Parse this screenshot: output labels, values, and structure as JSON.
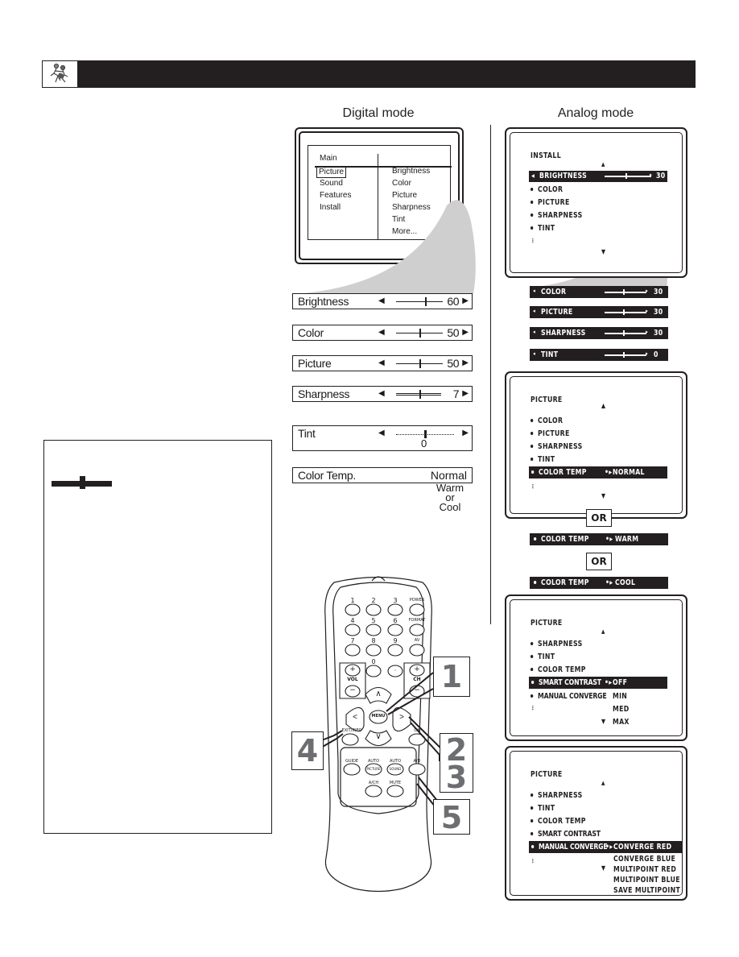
{
  "header": {
    "icon": "wrestlers-icon",
    "accent_color": "#231f20"
  },
  "digital": {
    "title": "Digital mode",
    "menu": {
      "left_header": "Main",
      "left_items": [
        "Picture",
        "Sound",
        "Features",
        "Install"
      ],
      "selected_left": "Picture",
      "right_items": [
        "Brightness",
        "Color",
        "Picture",
        "Sharpness",
        "Tint",
        "More..."
      ]
    },
    "rows": [
      {
        "label": "Brightness",
        "value": "60",
        "position": 0.62
      },
      {
        "label": "Color",
        "value": "50",
        "position": 0.5
      },
      {
        "label": "Picture",
        "value": "50",
        "position": 0.5
      },
      {
        "label": "Sharpness",
        "value": "7",
        "position": 0.5
      },
      {
        "label": "Tint",
        "value": "0",
        "position": 0.5
      }
    ],
    "color_temp": {
      "label": "Color Temp.",
      "value": "Normal",
      "alternatives": [
        "Warm",
        "or",
        "Cool"
      ]
    }
  },
  "analog": {
    "title": "Analog mode",
    "screen1": {
      "title": "INSTALL",
      "highlight": {
        "label": "BRIGHTNESS",
        "value": "30",
        "position": 0.45
      },
      "items": [
        "COLOR",
        "PICTURE",
        "SHARPNESS",
        "TINT"
      ]
    },
    "bars": [
      {
        "label": "COLOR",
        "value": "30",
        "position": 0.45
      },
      {
        "label": "PICTURE",
        "value": "30",
        "position": 0.45
      },
      {
        "label": "SHARPNESS",
        "value": "30",
        "position": 0.45
      },
      {
        "label": "TINT",
        "value": "0",
        "position": 0.45
      }
    ],
    "screen2": {
      "title": "PICTURE",
      "items": [
        "COLOR",
        "PICTURE",
        "SHARPNESS",
        "TINT"
      ],
      "highlight": {
        "label": "COLOR TEMP",
        "value": "NORMAL"
      }
    },
    "or_label": "OR",
    "color_temp_alts": [
      {
        "label": "COLOR TEMP",
        "value": "WARM"
      },
      {
        "label": "COLOR TEMP",
        "value": "COOL"
      }
    ],
    "screen3": {
      "title": "PICTURE",
      "items": [
        "SHARPNESS",
        "TINT",
        "COLOR TEMP"
      ],
      "highlight": {
        "label": "SMART CONTRAST",
        "value": "OFF"
      },
      "after_item": "MANUAL CONVERGE",
      "options": [
        "MIN",
        "MED",
        "MAX"
      ]
    },
    "screen4": {
      "title": "PICTURE",
      "items": [
        "SHARPNESS",
        "TINT",
        "COLOR TEMP",
        "SMART CONTRAST"
      ],
      "highlight": {
        "label": "MANUAL CONVERGE",
        "value": "CONVERGE RED"
      },
      "options": [
        "CONVERGE BLUE",
        "MULTIPOINT RED",
        "MULTIPOINT BLUE",
        "SAVE MULTIPOINT"
      ]
    }
  },
  "remote": {
    "number_keys": [
      "1",
      "2",
      "3",
      "4",
      "5",
      "6",
      "7",
      "8",
      "9",
      "0",
      "·"
    ],
    "side_keys": [
      "POWER",
      "FORMAT",
      "AV"
    ],
    "vol_label": "VOL",
    "ch_label": "CH",
    "plus": "+",
    "minus": "−",
    "menu_label": "MENU",
    "exit_label": "EXIT/INFO",
    "ok_label": "OK",
    "lower_keys": [
      "GUIDE",
      "AUTO",
      "AUTO",
      "A/D",
      "A/CH",
      "MUTE"
    ],
    "lower_sub": [
      "PICTURE",
      "SOUND"
    ],
    "steps": [
      "1",
      "2",
      "3",
      "4",
      "5"
    ]
  }
}
